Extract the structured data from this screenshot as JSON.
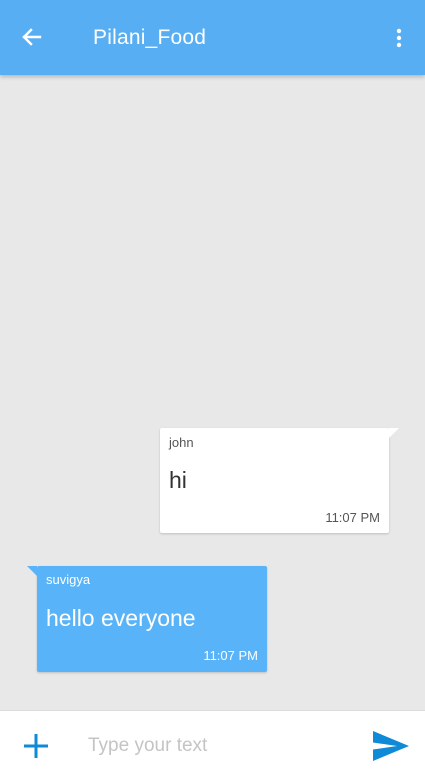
{
  "app_bar": {
    "title": "Pilani_Food",
    "background_color": "#58aef3",
    "back_icon": "arrow-back-icon",
    "menu_icon": "more-vert-icon"
  },
  "chat": {
    "background_color": "#e8e8e8",
    "messages": [
      {
        "sender": "john",
        "text": "hi",
        "time": "11:07 PM",
        "direction": "outgoing",
        "bubble_color": "#ffffff"
      },
      {
        "sender": "suvigya",
        "text": "hello everyone",
        "time": "11:07 PM",
        "direction": "incoming",
        "bubble_color": "#58b3f8"
      }
    ]
  },
  "composer": {
    "placeholder": "Type your text",
    "value": "",
    "add_icon": "plus-icon",
    "send_icon": "send-icon",
    "accent_color": "#0f8ad6"
  }
}
